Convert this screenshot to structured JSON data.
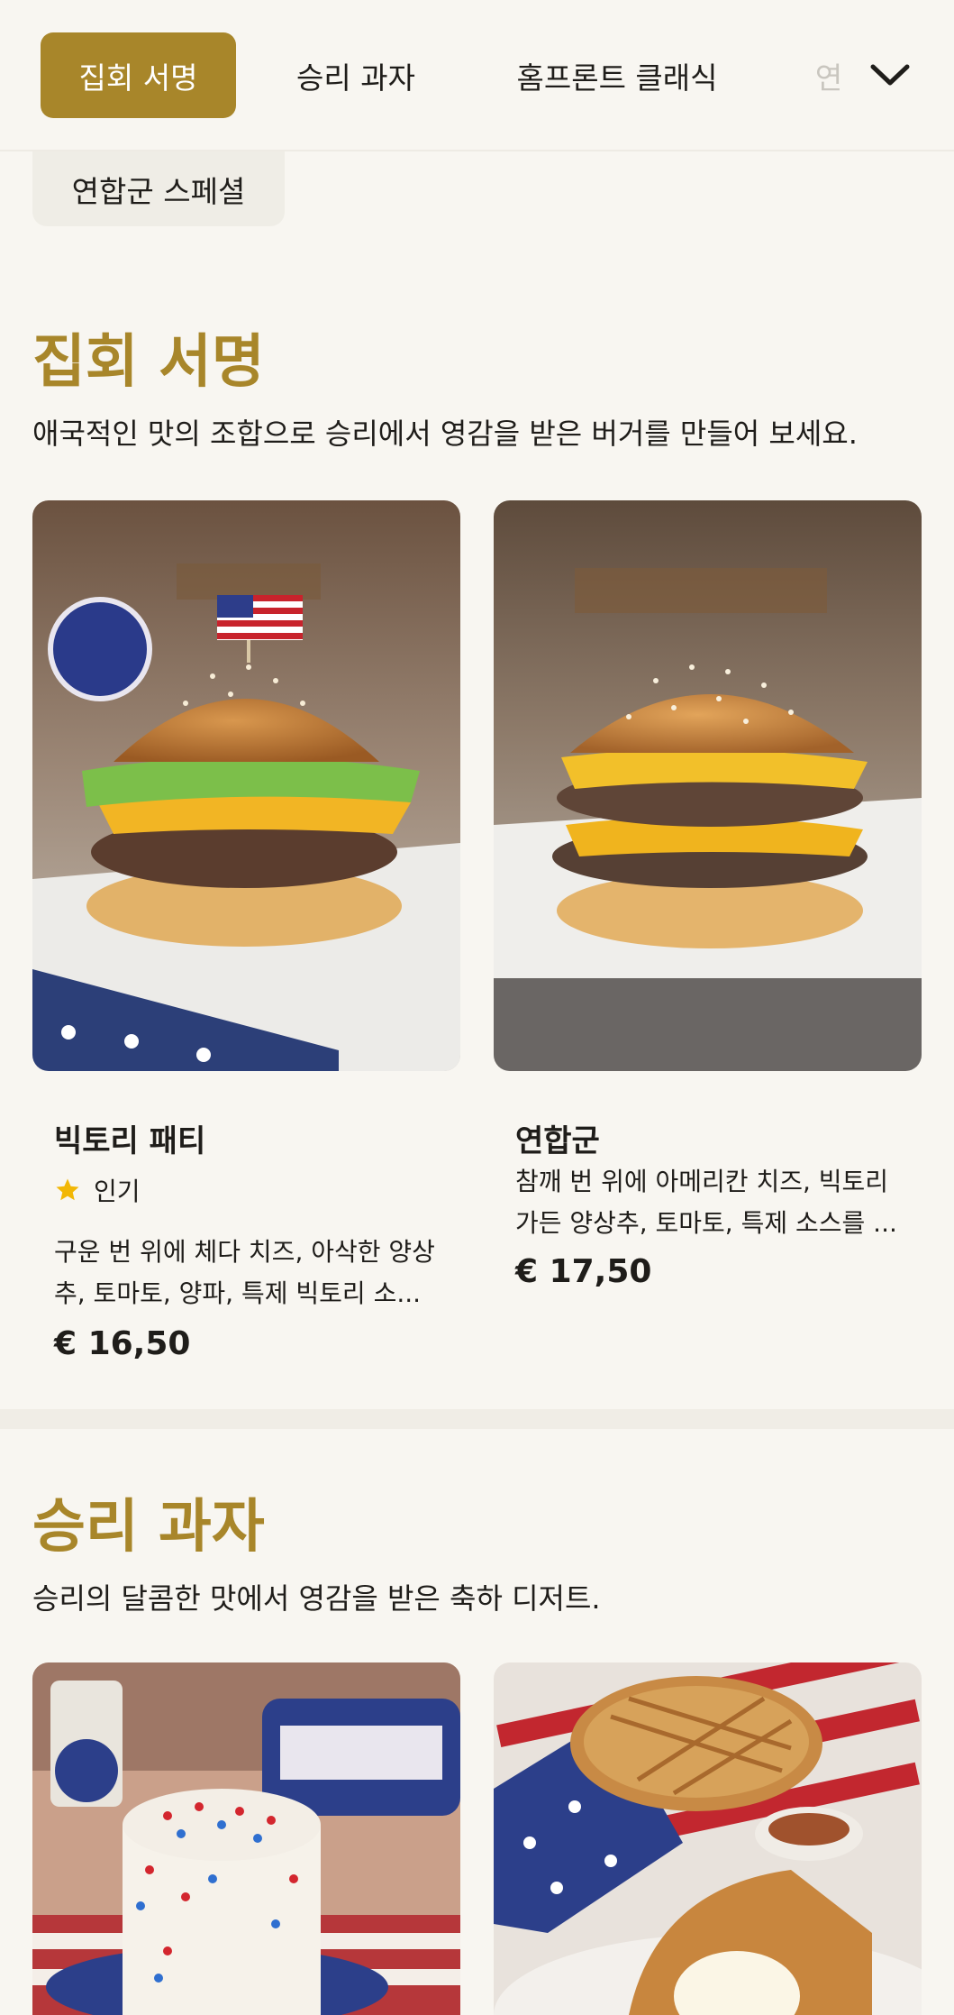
{
  "nav": {
    "tabs": [
      {
        "label": "집회 서명",
        "active": true
      },
      {
        "label": "승리 과자",
        "active": false
      },
      {
        "label": "홈프론트 클래식",
        "active": false
      },
      {
        "label": "연",
        "active": false
      }
    ],
    "expand_icon": "chevron-down-icon",
    "chip_label": "연합군 스페셜"
  },
  "sections": [
    {
      "title": "집회 서명",
      "description": "애국적인 맛의 조합으로 승리에서 영감을 받은 버거를 만들어 보세요.",
      "items": [
        {
          "name": "빅토리 패티",
          "badge": "인기",
          "badge_icon": "star-icon",
          "description_line1": "구운 번 위에 체다 치즈, 아삭한 양상",
          "description_line2": "추, 토마토, 양파, 특제 빅토리 소...",
          "price": "€ 16,50"
        },
        {
          "name": "연합군",
          "description_line1": "참깨 번 위에 아메리칸 치즈, 빅토리",
          "description_line2": "가든 양상추, 토마토, 특제 소스를 ...",
          "price": "€ 17,50"
        }
      ]
    },
    {
      "title": "승리 과자",
      "description": "승리의 달콤한 맛에서 영감을 받은 축하 디저트."
    }
  ],
  "colors": {
    "accent": "#a8862a",
    "background": "#f8f6f1",
    "star": "#f2b705"
  }
}
